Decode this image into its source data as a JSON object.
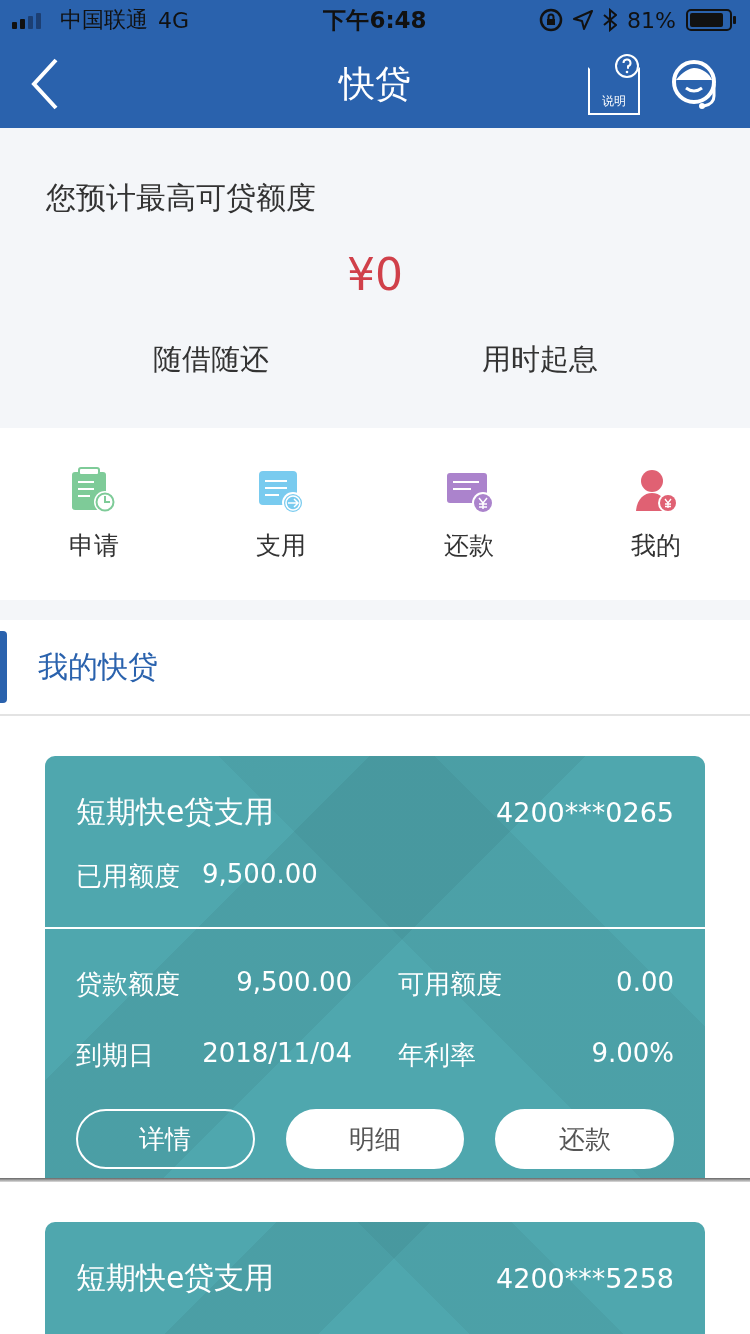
{
  "status_bar": {
    "carrier": "中国联通",
    "network": "4G",
    "time": "下午6:48",
    "battery": "81%"
  },
  "nav": {
    "title": "快贷",
    "help_label": "说明"
  },
  "summary": {
    "label": "您预计最高可贷额度",
    "amount": "¥0",
    "features": [
      "随借随还",
      "用时起息"
    ]
  },
  "shortcuts": [
    {
      "kind": "apply",
      "label": "申请"
    },
    {
      "kind": "use",
      "label": "支用"
    },
    {
      "kind": "repay",
      "label": "还款"
    },
    {
      "kind": "mine",
      "label": "我的"
    }
  ],
  "section": {
    "title": "我的快贷"
  },
  "loans": [
    {
      "name": "短期快e贷支用",
      "account": "4200***0265",
      "used_label": "已用额度",
      "used": "9,500.00",
      "details": [
        {
          "label": "贷款额度",
          "value": "9,500.00"
        },
        {
          "label": "可用额度",
          "value": "0.00"
        },
        {
          "label": "到期日",
          "value": "2018/11/04"
        },
        {
          "label": "年利率",
          "value": "9.00%"
        }
      ],
      "buttons": [
        {
          "kind": "outline",
          "label": "详情"
        },
        {
          "kind": "filled",
          "label": "明细"
        },
        {
          "kind": "filled",
          "label": "还款"
        }
      ]
    },
    {
      "name": "短期快e贷支用",
      "account": "4200***5258"
    }
  ]
}
